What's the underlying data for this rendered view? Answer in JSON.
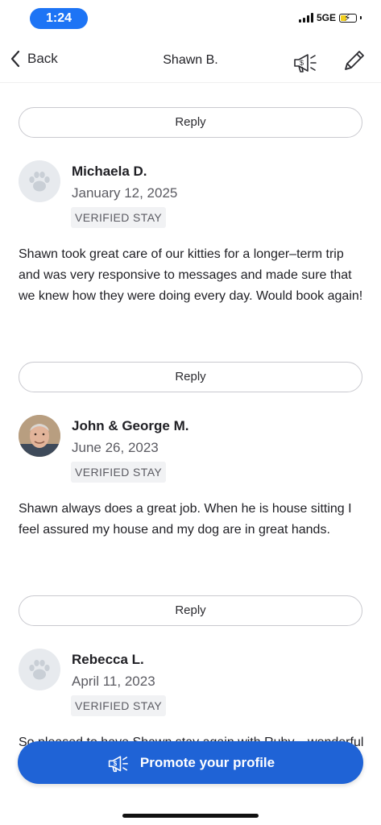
{
  "status_bar": {
    "time": "1:24",
    "network": "5GE"
  },
  "nav": {
    "back_label": "Back",
    "title": "Shawn B."
  },
  "reply_label": "Reply",
  "reviews": [
    {
      "name": "Michaela D.",
      "date": "January 12, 2025",
      "badge": "VERIFIED STAY",
      "avatar": "paw-icon",
      "text": "Shawn took great care of our kitties for a longer–term trip and was very responsive to messages and made sure that we knew how they were doing every day. Would book again!"
    },
    {
      "name": "John & George M.",
      "date": "June 26, 2023",
      "badge": "VERIFIED STAY",
      "avatar": "photo",
      "text": "Shawn always does a great job. When he is house sitting I feel assured my house and my dog are in great hands."
    },
    {
      "name": "Rebecca L.",
      "date": "April 11, 2023",
      "badge": "VERIFIED STAY",
      "avatar": "paw-icon",
      "text": "So pleased to have Shawn stay again with Ruby... wonderful person."
    }
  ],
  "promote": {
    "label": "Promote your profile",
    "color": "#1f63d6"
  }
}
